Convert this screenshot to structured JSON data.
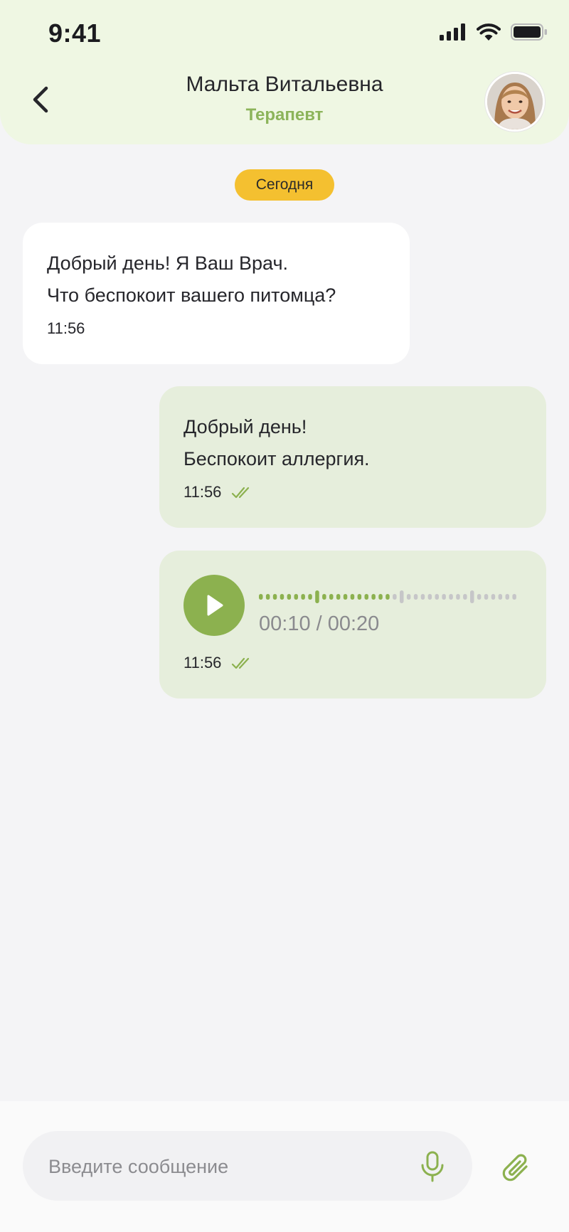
{
  "status_bar": {
    "time": "9:41",
    "icons": [
      "signal-icon",
      "wifi-icon",
      "battery-icon"
    ]
  },
  "header": {
    "back_icon": "chevron-left-icon",
    "contact_name": "Мальта Витальевна",
    "contact_role": "Терапевт",
    "avatar": "doctor-avatar",
    "role_color": "#8cb45a"
  },
  "chat": {
    "date_label": "Сегодня",
    "messages": [
      {
        "direction": "incoming",
        "lines": [
          "Добрый день! Я Ваш Врач.",
          "Что беспокоит вашего питомца?"
        ],
        "time": "11:56"
      },
      {
        "direction": "outgoing",
        "lines": [
          "Добрый день!",
          "Беспокоит аллергия."
        ],
        "time": "11:56",
        "status_icon": "double-check-icon"
      },
      {
        "direction": "outgoing",
        "type": "voice",
        "position_label": "00:10 / 00:20",
        "progress": 0.5,
        "time": "11:56",
        "status_icon": "double-check-icon"
      }
    ]
  },
  "composer": {
    "placeholder": "Введите сообщение",
    "value": "",
    "mic_icon": "microphone-icon",
    "attach_icon": "paperclip-icon"
  },
  "colors": {
    "accent": "#8cb14f",
    "header_bg": "#eff7e3",
    "outgoing_bubble": "#e6eedc",
    "incoming_bubble": "#ffffff",
    "date_pill": "#f4c030",
    "waveform_played": "#8cb14f",
    "waveform_unplayed": "#c6c6c8"
  }
}
